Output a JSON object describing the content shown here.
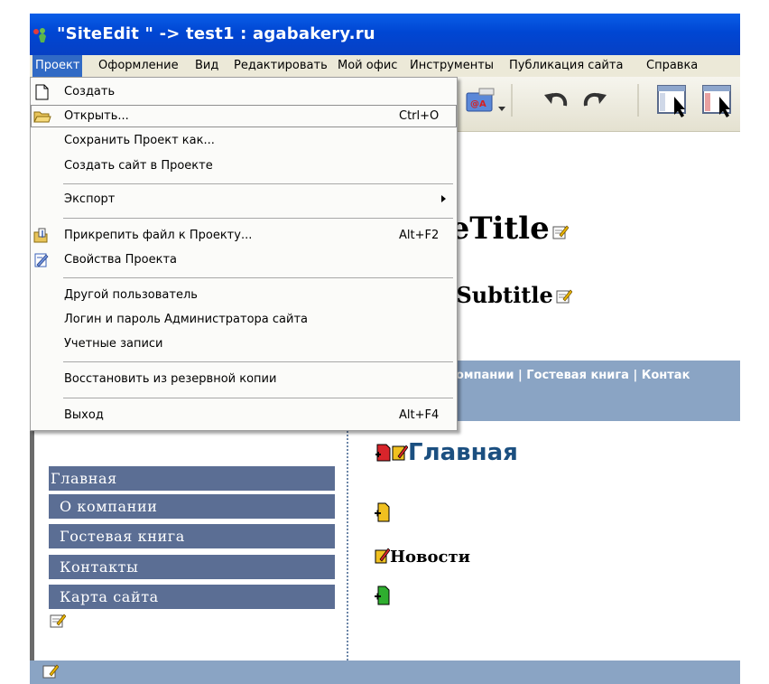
{
  "window": {
    "title": "\"SiteEdit \" -> test1 : agabakery.ru"
  },
  "menubar": {
    "items": [
      {
        "label": "Проект",
        "active": true
      },
      {
        "label": "Оформление"
      },
      {
        "label": "Вид"
      },
      {
        "label": "Редактировать"
      },
      {
        "label": "Мой офис"
      },
      {
        "label": "Инструменты"
      },
      {
        "label": "Публикация сайта"
      },
      {
        "label": "Справка"
      }
    ]
  },
  "dropdown": {
    "items": [
      {
        "label": "Создать",
        "icon": "new-page-icon"
      },
      {
        "label": "Открыть...",
        "shortcut": "Ctrl+O",
        "icon": "open-folder-icon"
      },
      {
        "label": "Сохранить Проект как..."
      },
      {
        "label": "Создать сайт в Проекте"
      },
      {
        "label": "Экспорт",
        "submenu": true
      },
      {
        "label": "Прикрепить файл к Проекту...",
        "shortcut": "Alt+F2",
        "icon": "attach-file-icon"
      },
      {
        "label": "Свойства Проекта",
        "icon": "properties-icon"
      },
      {
        "label": "Другой пользователь"
      },
      {
        "label": "Логин и пароль Администратора сайта"
      },
      {
        "label": "Учетные записи"
      },
      {
        "label": "Восстановить из резервной копии"
      },
      {
        "label": "Выход",
        "shortcut": "Alt+F4"
      }
    ]
  },
  "toolbar": {
    "icons": [
      "email-link-icon",
      "dropdown-arrow-icon",
      "undo-icon",
      "redo-icon",
      "layout-select-icon",
      "layout-select-2-icon"
    ],
    "email_label": "@A"
  },
  "site": {
    "title": "iteTitle",
    "subtitle": "iteSubtitle",
    "topnav": "омпании  |  Гостевая книга  |  Контак",
    "sidebar": [
      "Главная",
      "О компании",
      "Гостевая книга",
      "Контакты",
      "Карта сайта"
    ],
    "heading_main": "Главная",
    "heading_news": "Новости"
  },
  "colors": {
    "titlebar": "#0a5ee8",
    "menu_active": "#316ac5",
    "sidebar": "#5b6e94",
    "nav_band": "#8aa4c4",
    "heading": "#1b4f80"
  }
}
